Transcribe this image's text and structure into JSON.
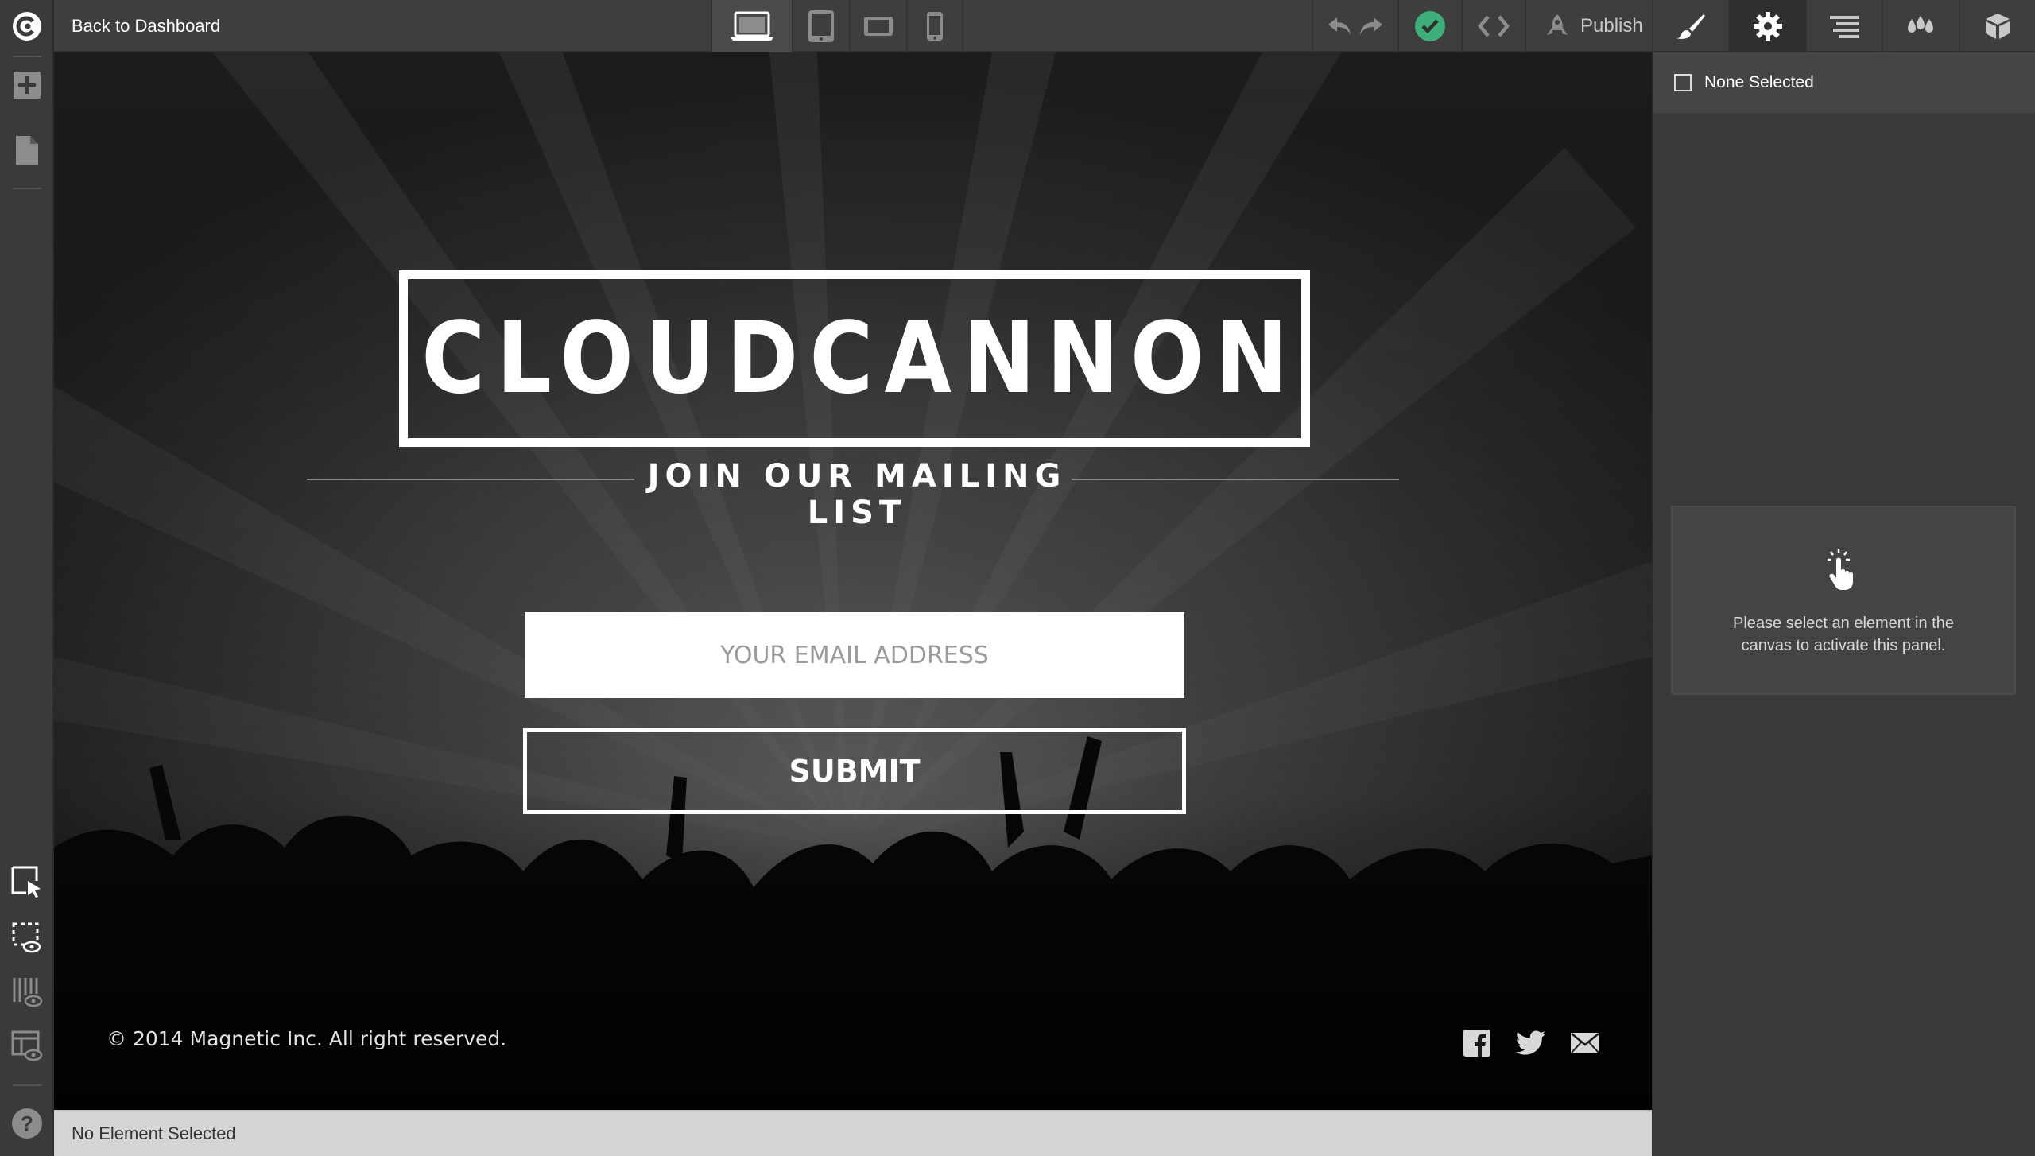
{
  "topbar": {
    "back_label": "Back to Dashboard",
    "publish_label": "Publish",
    "devices": [
      "laptop-icon",
      "tablet-icon",
      "tablet-landscape-icon",
      "phone-icon"
    ]
  },
  "left_rail": {
    "top_icons": [
      "cloudcannon-logo-icon",
      "add-icon",
      "page-icon"
    ],
    "bottom_icons": [
      "select-cursor-icon",
      "visibility-dashed-icon",
      "visibility-columns-icon",
      "visibility-layout-icon",
      "help-icon"
    ]
  },
  "panel": {
    "tabs": [
      "brush-icon",
      "gear-icon",
      "align-icon",
      "drops-icon",
      "cube-icon"
    ],
    "active_tab": "gear-icon",
    "none_selected": "None Selected",
    "inactive_message": "Please select an element in the canvas to activate this panel."
  },
  "canvas": {
    "logo_text": "CLOUDCANNON",
    "subtitle": "JOIN OUR MAILING LIST",
    "email_placeholder": "YOUR EMAIL ADDRESS",
    "submit_label": "SUBMIT",
    "copyright": "© 2014 Magnetic Inc. All right reserved.",
    "social_icons": [
      "facebook-icon",
      "twitter-icon",
      "mail-icon"
    ]
  },
  "status": {
    "text": "No Element Selected"
  },
  "colors": {
    "saved_green": "#3fae7a",
    "chrome_dark": "#3e3e3e",
    "panel_bg": "#393939",
    "status_bg": "#d5d5d5"
  }
}
